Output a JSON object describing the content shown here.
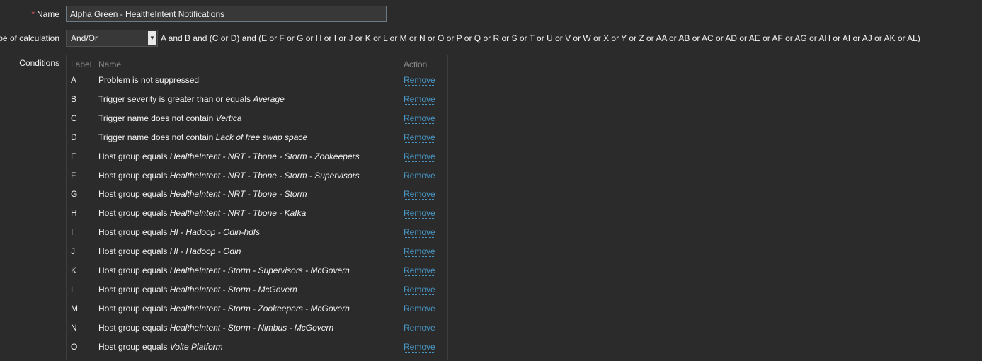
{
  "form": {
    "name_label": "Name",
    "required_mark": "*",
    "name_value": "Alpha Green - HealtheIntent Notifications",
    "calc_label": "Type of calculation",
    "calc_value": "And/Or",
    "formula": "A and B and (C or D) and (E or F or G or H or I or J or K or L or M or N or O or P or Q or R or S or T or U or V or W or X or Y or Z or AA or AB or AC or AD or AE or AF or AG or AH or AI or AJ or AK or AL)",
    "conditions_label": "Conditions"
  },
  "table": {
    "headers": {
      "label": "Label",
      "name": "Name",
      "action": "Action"
    },
    "rows": [
      {
        "label": "A",
        "prefix": "Problem is not suppressed",
        "value": "",
        "action": "Remove"
      },
      {
        "label": "B",
        "prefix": "Trigger severity is greater than or equals ",
        "value": "Average",
        "action": "Remove"
      },
      {
        "label": "C",
        "prefix": "Trigger name does not contain ",
        "value": "Vertica",
        "action": "Remove"
      },
      {
        "label": "D",
        "prefix": "Trigger name does not contain ",
        "value": "Lack of free swap space",
        "action": "Remove"
      },
      {
        "label": "E",
        "prefix": "Host group equals ",
        "value": "HealtheIntent - NRT - Tbone - Storm - Zookeepers",
        "action": "Remove"
      },
      {
        "label": "F",
        "prefix": "Host group equals ",
        "value": "HealtheIntent - NRT - Tbone - Storm - Supervisors",
        "action": "Remove"
      },
      {
        "label": "G",
        "prefix": "Host group equals ",
        "value": "HealtheIntent - NRT - Tbone - Storm",
        "action": "Remove"
      },
      {
        "label": "H",
        "prefix": "Host group equals ",
        "value": "HealtheIntent - NRT - Tbone - Kafka",
        "action": "Remove"
      },
      {
        "label": "I",
        "prefix": "Host group equals ",
        "value": "HI - Hadoop - Odin-hdfs",
        "action": "Remove"
      },
      {
        "label": "J",
        "prefix": "Host group equals ",
        "value": "HI - Hadoop - Odin",
        "action": "Remove"
      },
      {
        "label": "K",
        "prefix": "Host group equals ",
        "value": "HealtheIntent - Storm - Supervisors - McGovern",
        "action": "Remove"
      },
      {
        "label": "L",
        "prefix": "Host group equals ",
        "value": "HealtheIntent - Storm - McGovern",
        "action": "Remove"
      },
      {
        "label": "M",
        "prefix": "Host group equals ",
        "value": "HealtheIntent - Storm - Zookeepers - McGovern",
        "action": "Remove"
      },
      {
        "label": "N",
        "prefix": "Host group equals ",
        "value": "HealtheIntent - Storm - Nimbus - McGovern",
        "action": "Remove"
      },
      {
        "label": "O",
        "prefix": "Host group equals ",
        "value": "Volte Platform",
        "action": "Remove"
      }
    ]
  }
}
